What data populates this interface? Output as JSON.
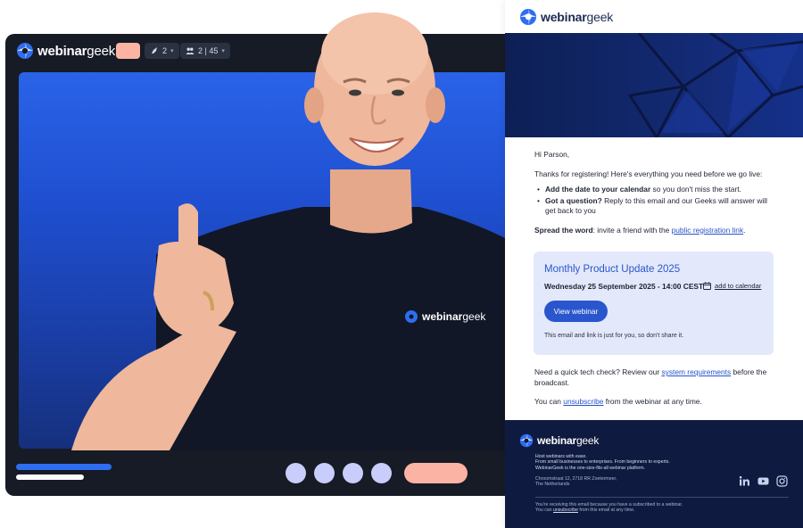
{
  "brand": {
    "name_bold": "webinar",
    "name_light": "geek",
    "accent": "#2a56cd",
    "salmon": "#fbb3a4",
    "dark": "#161b26"
  },
  "player": {
    "chip_presenters": "2",
    "chip_attendees": "2 | 45",
    "icons": [
      "rocket-icon",
      "people-icon",
      "chevron-down-icon"
    ]
  },
  "shirt_logo": {
    "name_bold": "webinar",
    "name_light": "geek"
  },
  "email": {
    "greeting": "Hi Parson,",
    "intro": "Thanks for registering! Here's everything you need before we go live:",
    "bullets": [
      {
        "bold": "Add the date to your calendar",
        "rest": " so you don't miss the start."
      },
      {
        "bold": "Got a question?",
        "rest": " Reply to this email and our Geeks will answer will get back to you"
      }
    ],
    "spread_bold": "Spread the word",
    "spread_text": ": invite a friend with the ",
    "spread_link": "public registration link",
    "spread_end": ".",
    "event": {
      "title": "Monthly Product Update 2025",
      "date": "Wednesday 25 September 2025 - 14:00 CEST",
      "calendar_link": "add to calendar",
      "button": "View webinar",
      "note": "This email and link is just for you, so don't share it."
    },
    "tech_pre": "Need a quick tech check? Review our ",
    "tech_link": "system requirements",
    "tech_post": " before the broadcast.",
    "unsub_pre": "You can ",
    "unsub_link": "unsubscribe",
    "unsub_post": " from the webinar at any time.",
    "footer": {
      "tagline_1": "Host webinars with ease.",
      "tagline_2": "From small businesses to enterprises. From beginners to experts.",
      "tagline_3": "WebinarGeek is the one-size-fits-all webinar platform.",
      "address_1": "Chroomstraat 12, 2718 RR Zoetermeer,",
      "address_2": "The Netherlands",
      "legal_1": "You're receiving this email because you have a subscribed to a webinar.",
      "legal_2_pre": "You can ",
      "legal_2_link": "unsubscribe",
      "legal_2_post": " from this email at any time.",
      "social": [
        "linkedin-icon",
        "youtube-icon",
        "instagram-icon"
      ]
    }
  }
}
